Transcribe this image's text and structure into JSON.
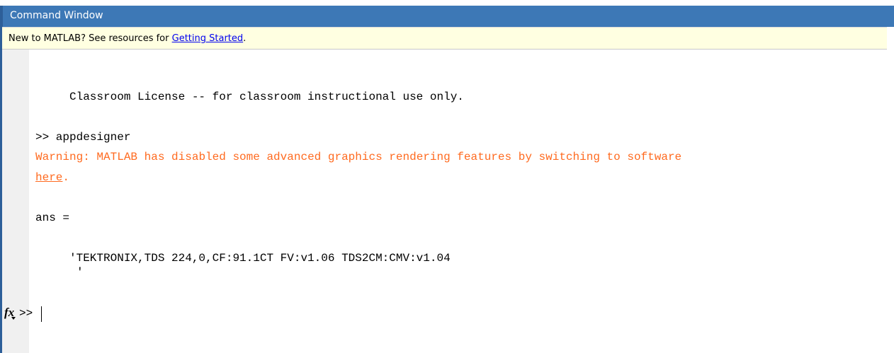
{
  "window": {
    "title": "Command Window"
  },
  "banner": {
    "prefix": "New to MATLAB? See resources for ",
    "link": "Getting Started",
    "suffix": "."
  },
  "console": {
    "license_line": "Classroom License -- for classroom instructional use only.",
    "command_line": ">> appdesigner",
    "warning_line": "Warning: MATLAB has disabled some advanced graphics rendering features by switching to software",
    "warning_link": "here",
    "warning_link_suffix": ".",
    "ans_line": "ans =",
    "result_line": "'TEKTRONIX,TDS 224,0,CF:91.1CT FV:v1.06 TDS2CM:CMV:v1.04",
    "result_quote": "'"
  },
  "prompt": {
    "fx_label": "fx",
    "prompt_text": ">>"
  },
  "colors": {
    "title_bar": "#3d78b6",
    "banner_bg": "#ffffe1",
    "warning": "#ff6a1f",
    "link": "#0000ee"
  }
}
